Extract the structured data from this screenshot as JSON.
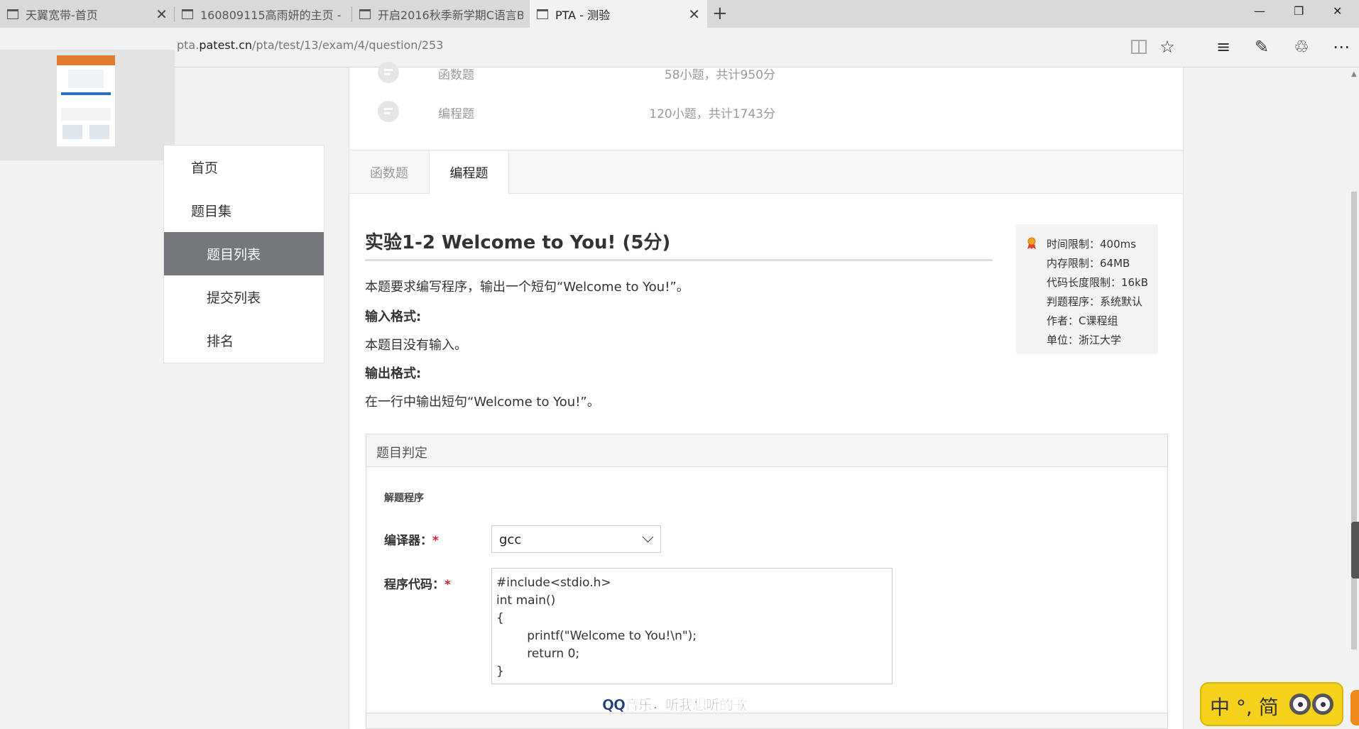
{
  "browser": {
    "tabs": [
      {
        "label": "天翼宽带-首页",
        "active": false
      },
      {
        "label": "160809115高雨妍的主页 - 轻",
        "active": false
      },
      {
        "label": "开启2016秋季新学期C语言B",
        "active": false
      },
      {
        "label": "PTA - 测验",
        "active": true
      }
    ],
    "new_tab": "+",
    "url_prefix": "pta.",
    "url_host": "patest.cn",
    "url_path": "/pta/test/13/exam/4/question/253",
    "window_controls": {
      "minimize": "—",
      "restore": "❐",
      "close": "✕"
    },
    "tab_close": "✕",
    "toolbar_icons": [
      "reading-view-icon",
      "favorite-star-icon",
      "hub-icon",
      "web-note-icon",
      "share-icon",
      "more-icon"
    ],
    "toolbar_glyphs": {
      "star": "☆",
      "hub": "≡",
      "note": "✎",
      "share": "♲",
      "more": "⋯"
    }
  },
  "sidenav": {
    "items": [
      {
        "label": "首页",
        "active": false
      },
      {
        "label": "题目集",
        "active": false
      },
      {
        "label": "题目列表",
        "active": true
      },
      {
        "label": "提交列表",
        "active": false
      },
      {
        "label": "排名",
        "active": false
      }
    ]
  },
  "stats": [
    {
      "name": "函数题",
      "value": "58小题，共计950分"
    },
    {
      "name": "编程题",
      "value": "120小题，共计1743分"
    }
  ],
  "type_tabs": [
    {
      "label": "函数题",
      "active": false
    },
    {
      "label": "编程题",
      "active": true
    }
  ],
  "problem": {
    "title": "实验1-2 Welcome to You!  (5分)",
    "description": "本题要求编写程序，输出一个短句“Welcome to You!”。",
    "input_heading": "输入格式:",
    "input_text": "本题目没有输入。",
    "output_heading": "输出格式:",
    "output_text": "在一行中输出短句“Welcome to You!”。"
  },
  "meta": {
    "lines": [
      "时间限制：400ms",
      "内存限制：64MB",
      "代码长度限制：16kB",
      "判题程序：系统默认",
      "作者：C课程组",
      "单位：浙江大学"
    ]
  },
  "judge": {
    "title": "题目判定",
    "subtitle": "解题程序",
    "compiler_label": "编译器：",
    "compiler_value": "gcc",
    "code_label": "程序代码：",
    "required_mark": "*",
    "code_lines": [
      "#include<stdio.h>",
      "int main()",
      "{",
      "        printf(\"Welcome to You!\\n\");",
      "        return 0;",
      "}"
    ]
  },
  "overlay": {
    "qq_banner": "QQ音乐，听我想听的歌",
    "ime_text": "中 °, 简"
  },
  "colors": {
    "active_nav": "#72787c",
    "required": "#d9232d",
    "ime_bg": "#f7d21c"
  }
}
